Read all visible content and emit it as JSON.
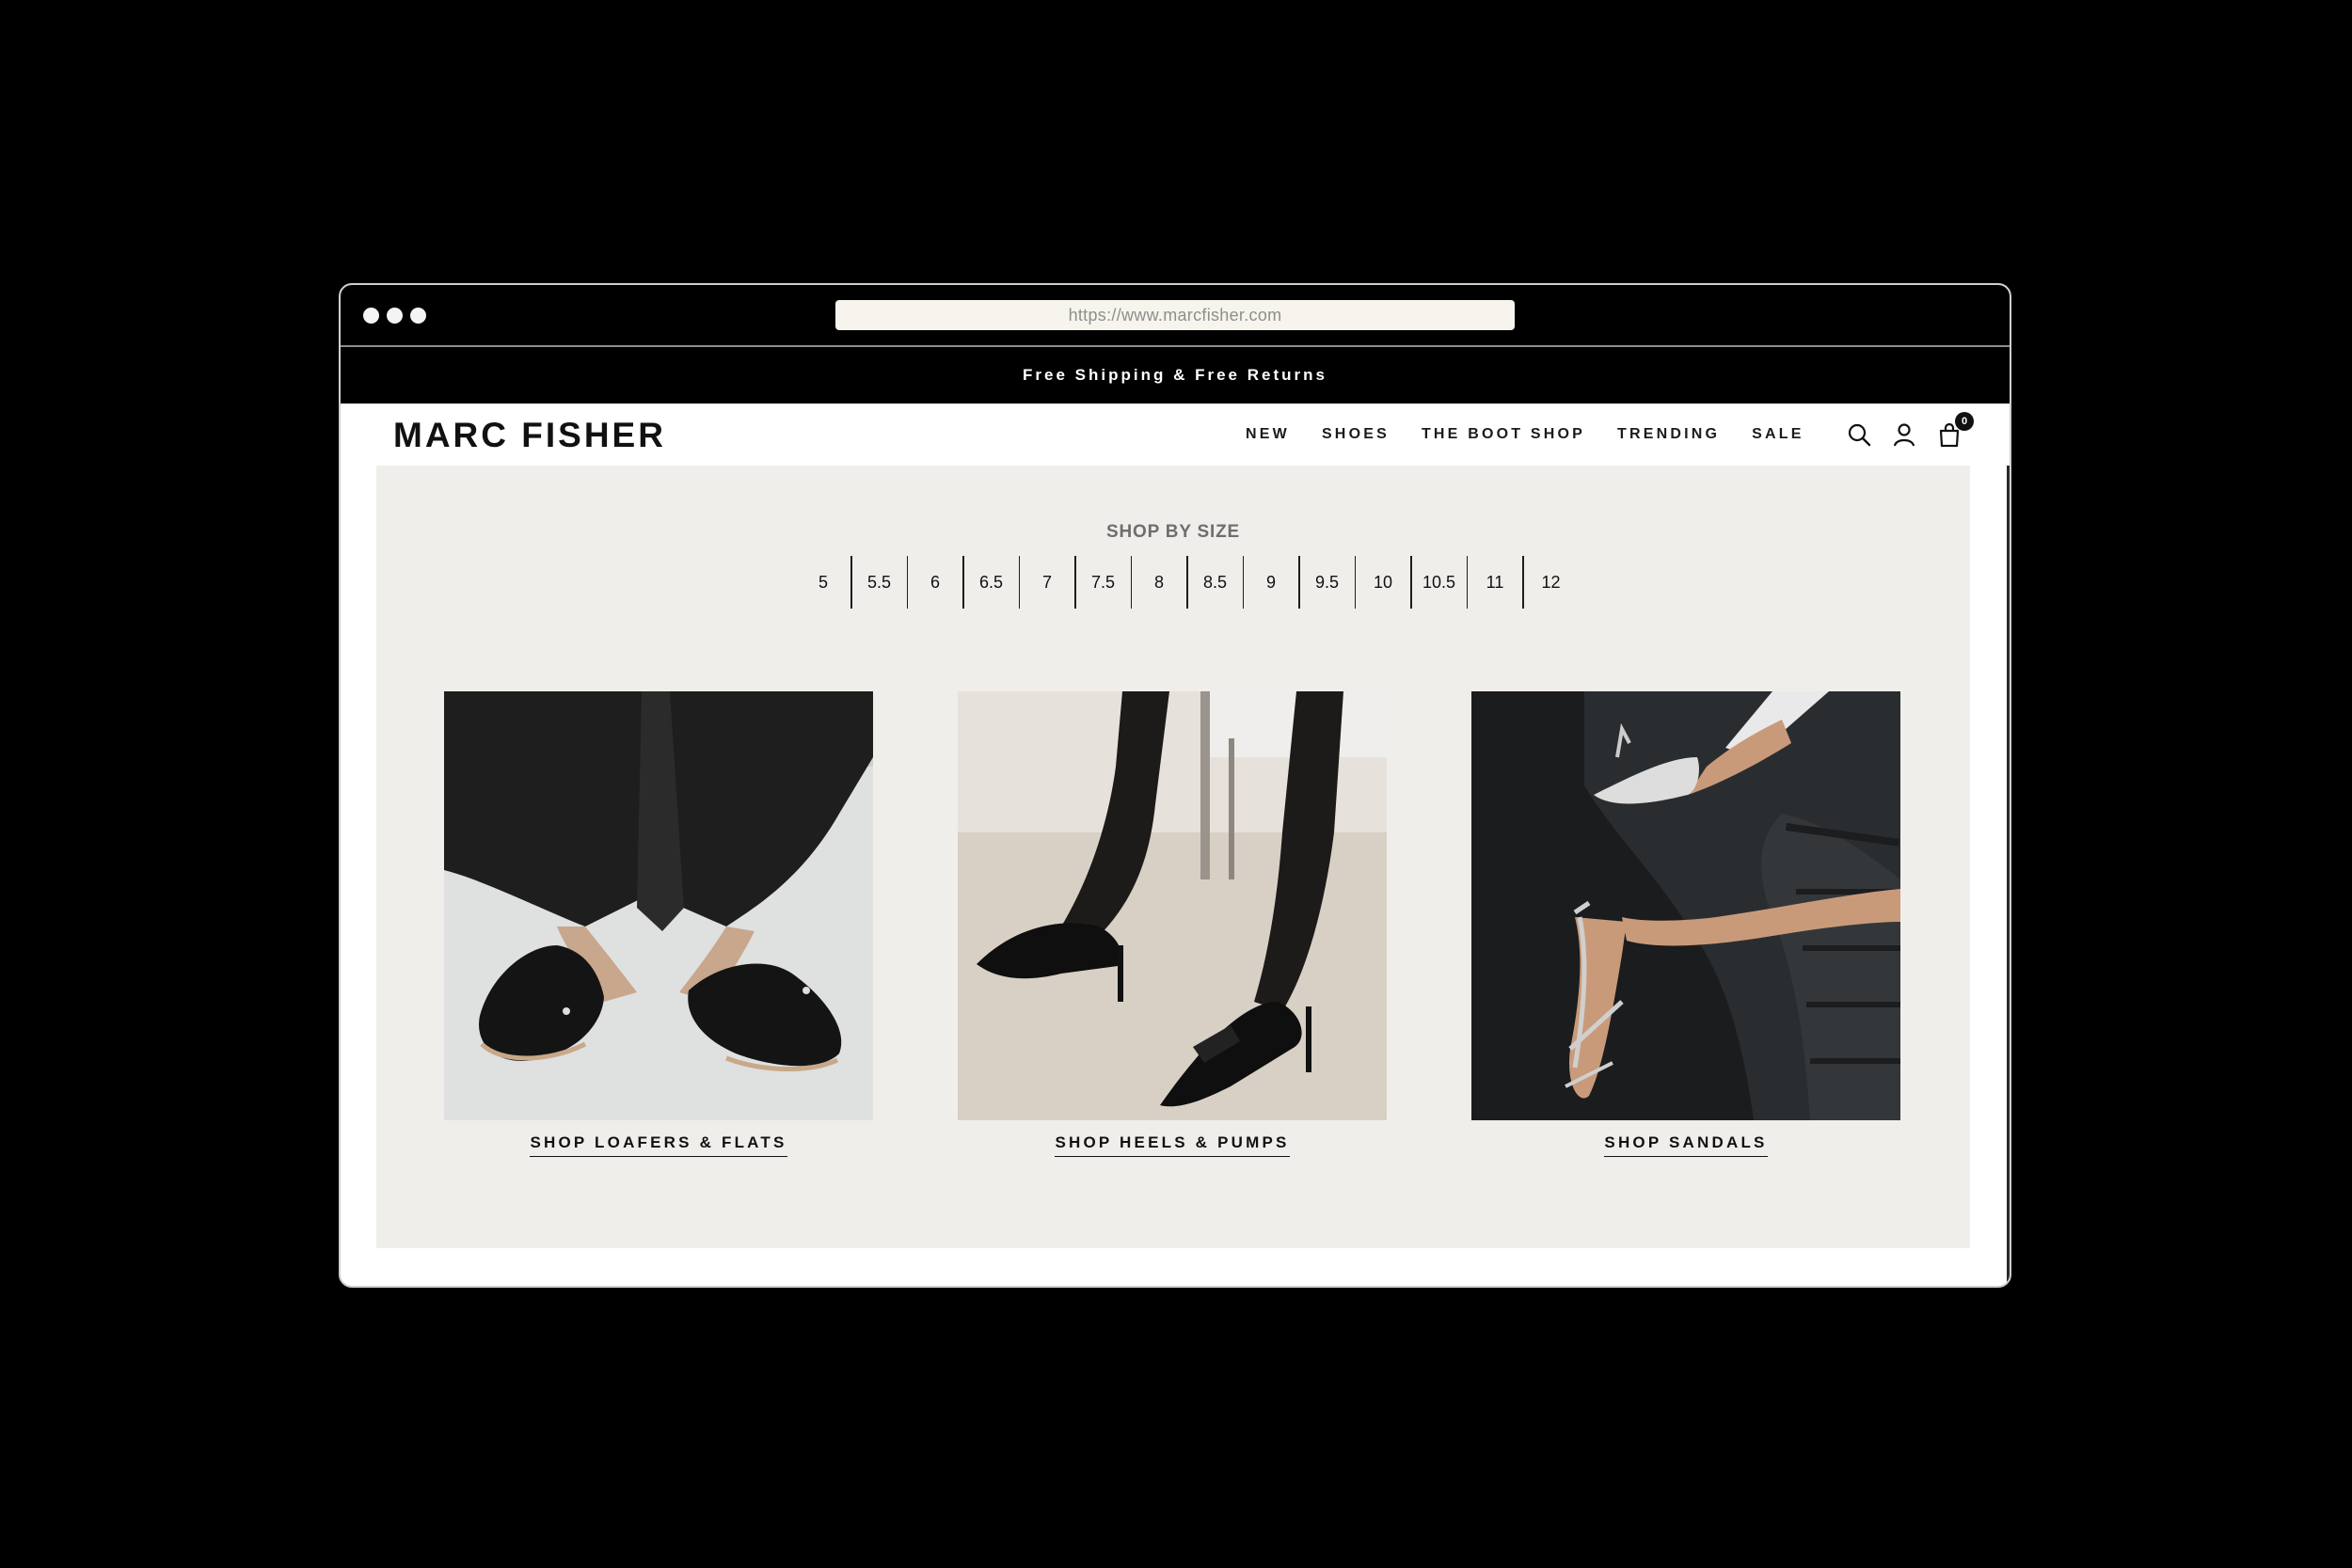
{
  "browser": {
    "url": "https://www.marcfisher.com"
  },
  "announcement": "Free Shipping & Free Returns",
  "header": {
    "logo": "MARC FISHER",
    "nav": [
      "NEW",
      "SHOES",
      "THE BOOT SHOP",
      "TRENDING",
      "SALE"
    ],
    "icons": [
      "search-icon",
      "account-icon",
      "bag-icon"
    ],
    "cart_count": "0"
  },
  "shop_by_size": {
    "title": "SHOP BY SIZE",
    "sizes": [
      "5",
      "5.5",
      "6",
      "6.5",
      "7",
      "7.5",
      "8",
      "8.5",
      "9",
      "9.5",
      "10",
      "10.5",
      "11",
      "12"
    ]
  },
  "categories": [
    {
      "label": "SHOP LOAFERS & FLATS"
    },
    {
      "label": "SHOP HEELS & PUMPS"
    },
    {
      "label": "SHOP SANDALS"
    }
  ],
  "colors": {
    "panel_bg": "#f0eeea",
    "chrome_bg": "#000000",
    "text": "#111111"
  }
}
